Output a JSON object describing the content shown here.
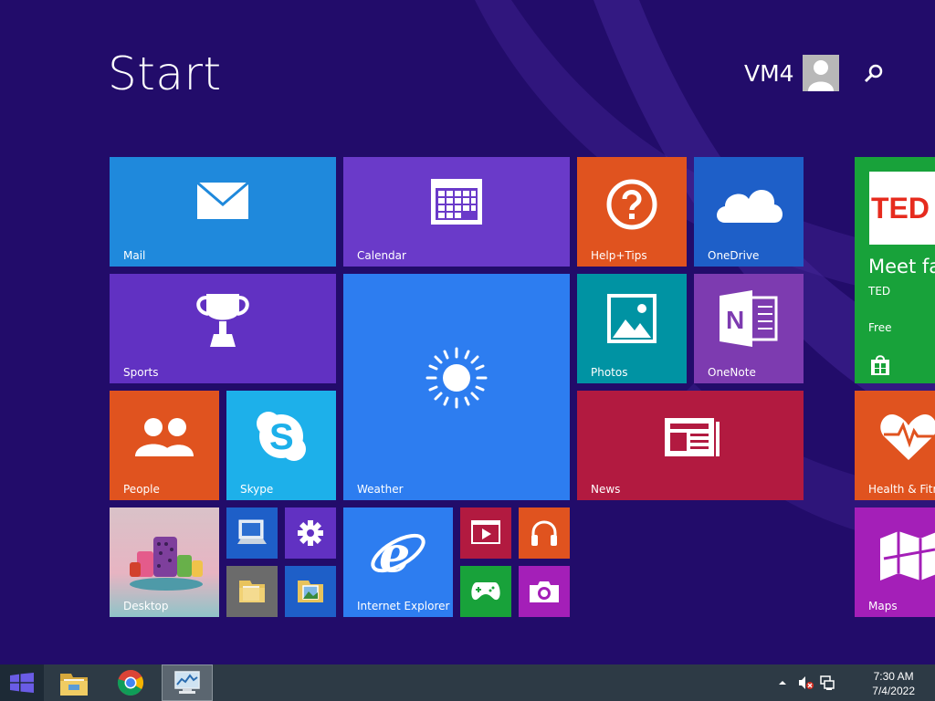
{
  "header": {
    "title": "Start",
    "user": "VM4"
  },
  "tiles": {
    "mail": "Mail",
    "calendar": "Calendar",
    "help": "Help+Tips",
    "onedrive": "OneDrive",
    "ted_title": "Meet fas",
    "ted_publisher": "TED",
    "ted_price": "Free",
    "ted_logo": "TED",
    "sports": "Sports",
    "weather": "Weather",
    "photos": "Photos",
    "onenote": "OneNote",
    "people": "People",
    "skype": "Skype",
    "news": "News",
    "health": "Health & Fitne",
    "desktop": "Desktop",
    "ie": "Internet Explorer",
    "maps": "Maps"
  },
  "colors": {
    "background": "#220c6a",
    "mail": "#1f89dc",
    "calendar": "#6a3ac9",
    "help": "#e0531f",
    "onedrive": "#1e5fc8",
    "ted": "#18a23a",
    "sports": "#6131c2",
    "weather": "#2d7df0",
    "photos": "#0093a3",
    "onenote": "#7d3bb0",
    "people": "#e0531f",
    "skype": "#1db0ea",
    "news": "#b21a40",
    "health": "#e0531f",
    "maps": "#a41fb8",
    "taskbar": "#2d3a45"
  },
  "taskbar": {
    "time": "7:30 AM",
    "date": "7/4/2022"
  }
}
